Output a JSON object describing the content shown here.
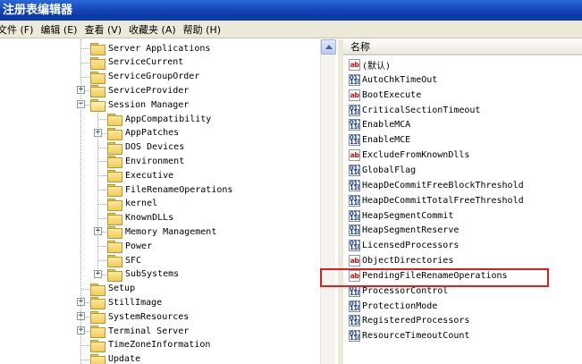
{
  "window": {
    "title": "注册表编辑器"
  },
  "menu": [
    "文件 (F)",
    "编辑 (E)",
    "查看 (V)",
    "收藏夹 (A)",
    "帮助 (H)"
  ],
  "tree": {
    "items": [
      {
        "label": "Server Applications",
        "level": 0,
        "expandable": false,
        "open": false
      },
      {
        "label": "ServiceCurrent",
        "level": 0,
        "expandable": false,
        "open": false
      },
      {
        "label": "ServiceGroupOrder",
        "level": 0,
        "expandable": false,
        "open": false
      },
      {
        "label": "ServiceProvider",
        "level": 0,
        "expandable": true,
        "open": false
      },
      {
        "label": "Session Manager",
        "level": 0,
        "expandable": true,
        "open": true
      },
      {
        "label": "AppCompatibility",
        "level": 1,
        "expandable": false,
        "open": false
      },
      {
        "label": "AppPatches",
        "level": 1,
        "expandable": true,
        "open": false
      },
      {
        "label": "DOS Devices",
        "level": 1,
        "expandable": false,
        "open": false
      },
      {
        "label": "Environment",
        "level": 1,
        "expandable": false,
        "open": false
      },
      {
        "label": "Executive",
        "level": 1,
        "expandable": false,
        "open": false
      },
      {
        "label": "FileRenameOperations",
        "level": 1,
        "expandable": false,
        "open": false
      },
      {
        "label": "kernel",
        "level": 1,
        "expandable": false,
        "open": false
      },
      {
        "label": "KnownDLLs",
        "level": 1,
        "expandable": false,
        "open": false
      },
      {
        "label": "Memory Management",
        "level": 1,
        "expandable": true,
        "open": false
      },
      {
        "label": "Power",
        "level": 1,
        "expandable": false,
        "open": false
      },
      {
        "label": "SFC",
        "level": 1,
        "expandable": false,
        "open": false
      },
      {
        "label": "SubSystems",
        "level": 1,
        "expandable": true,
        "open": false
      },
      {
        "label": "Setup",
        "level": 0,
        "expandable": false,
        "open": false
      },
      {
        "label": "StillImage",
        "level": 0,
        "expandable": true,
        "open": false
      },
      {
        "label": "SystemResources",
        "level": 0,
        "expandable": true,
        "open": false
      },
      {
        "label": "Terminal Server",
        "level": 0,
        "expandable": true,
        "open": false
      },
      {
        "label": "TimeZoneInformation",
        "level": 0,
        "expandable": false,
        "open": false
      },
      {
        "label": "Update",
        "level": 0,
        "expandable": false,
        "open": false
      }
    ]
  },
  "list": {
    "column_name": "名称",
    "values": [
      {
        "name": "(默认)",
        "type": "string"
      },
      {
        "name": "AutoChkTimeOut",
        "type": "binary"
      },
      {
        "name": "BootExecute",
        "type": "string"
      },
      {
        "name": "CriticalSectionTimeout",
        "type": "binary"
      },
      {
        "name": "EnableMCA",
        "type": "binary"
      },
      {
        "name": "EnableMCE",
        "type": "binary"
      },
      {
        "name": "ExcludeFromKnownDlls",
        "type": "string"
      },
      {
        "name": "GlobalFlag",
        "type": "binary"
      },
      {
        "name": "HeapDeCommitFreeBlockThreshold",
        "type": "binary"
      },
      {
        "name": "HeapDeCommitTotalFreeThreshold",
        "type": "binary"
      },
      {
        "name": "HeapSegmentCommit",
        "type": "binary"
      },
      {
        "name": "HeapSegmentReserve",
        "type": "binary"
      },
      {
        "name": "LicensedProcessors",
        "type": "binary"
      },
      {
        "name": "ObjectDirectories",
        "type": "string"
      },
      {
        "name": "PendingFileRenameOperations",
        "type": "string"
      },
      {
        "name": "ProcessorControl",
        "type": "binary"
      },
      {
        "name": "ProtectionMode",
        "type": "binary"
      },
      {
        "name": "RegisteredProcessors",
        "type": "binary"
      },
      {
        "name": "ResourceTimeoutCount",
        "type": "binary"
      }
    ],
    "highlighted": "PendingFileRenameOperations"
  },
  "icons": {
    "folder": "folder-icon",
    "string_value": "reg-sz-icon",
    "binary_value": "reg-dword-icon",
    "scroll_up": "scroll-up-arrow-icon"
  },
  "colors": {
    "highlight": "#e01e1e",
    "titlebar": "#0a3aa8"
  }
}
